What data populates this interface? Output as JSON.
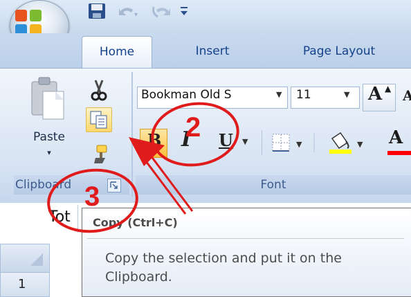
{
  "tabs": {
    "home": "Home",
    "insert": "Insert",
    "page_layout": "Page Layout"
  },
  "clipboard": {
    "paste_label": "Paste",
    "group_label": "Clipboard"
  },
  "font": {
    "name_value": "Bookman Old S",
    "size_value": "11",
    "grow_label": "A",
    "shrink_label": "A",
    "bold_label": "B",
    "italic_label": "I",
    "underline_label": "U",
    "color_label": "A",
    "group_label": "Font"
  },
  "sheet": {
    "cell_text": "Tot",
    "row_1": "1"
  },
  "tooltip": {
    "title": "Copy (Ctrl+C)",
    "body": "Copy the selection and put it on the Clipboard."
  },
  "annotations": {
    "step_2": "2",
    "step_3": "3"
  },
  "colors": {
    "annotation": "#e01b1b",
    "fill_color_bar": "#ffff00",
    "font_color_bar": "#ff0000",
    "tab_text": "#15428b"
  },
  "icons": {
    "office": "office-logo-icon",
    "save": "save-icon",
    "undo": "undo-icon",
    "redo": "redo-icon",
    "paste": "clipboard-paste-icon",
    "cut": "scissors-icon",
    "copy": "copy-icon",
    "format_painter": "paintbrush-icon",
    "borders": "borders-icon",
    "fill": "paint-bucket-icon",
    "dialog_launcher": "dialog-launcher-icon"
  }
}
